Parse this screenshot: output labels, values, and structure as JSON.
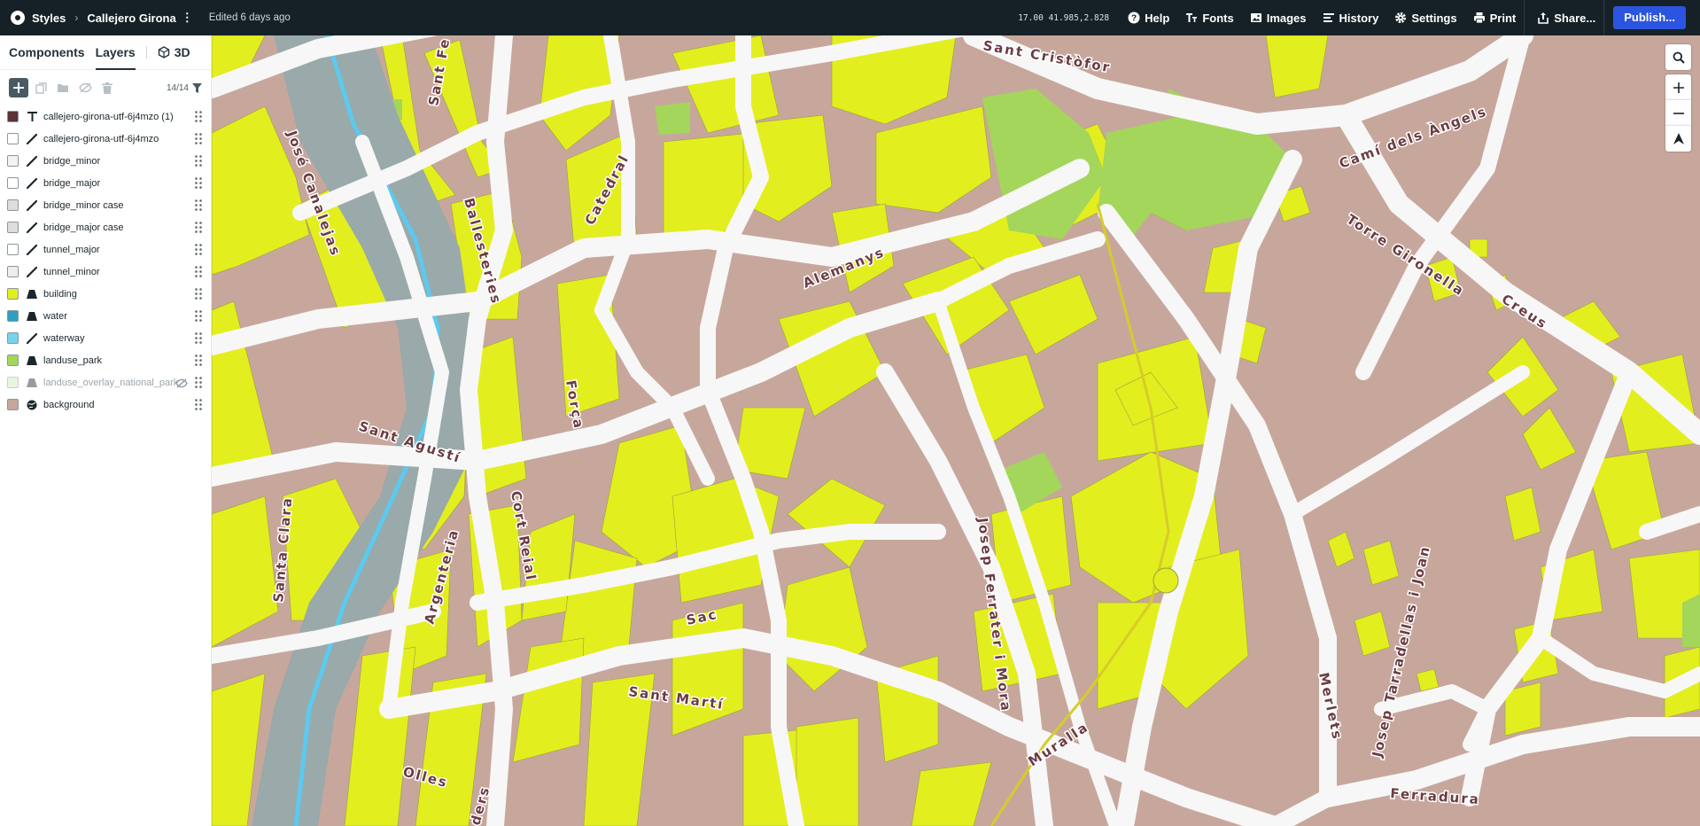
{
  "topbar": {
    "crumb_styles": "Styles",
    "crumb_map": "Callejero Girona",
    "edited": "Edited 6 days ago",
    "coords": "17.00 41.985,2.828",
    "help": "Help",
    "fonts": "Fonts",
    "images": "Images",
    "history": "History",
    "settings": "Settings",
    "print": "Print",
    "share": "Share...",
    "publish": "Publish..."
  },
  "sidebar": {
    "tabs": {
      "components": "Components",
      "layers": "Layers",
      "three_d": "3D"
    },
    "count": "14/14",
    "layers": [
      {
        "name": "callejero-girona-utf-6j4mzo (1)",
        "type": "symbol",
        "color": "#5a3338"
      },
      {
        "name": "callejero-girona-utf-6j4mzo",
        "type": "line",
        "color": "#ffffff"
      },
      {
        "name": "bridge_minor",
        "type": "line",
        "color": "#f3f3f3"
      },
      {
        "name": "bridge_major",
        "type": "line",
        "color": "#ffffff"
      },
      {
        "name": "bridge_minor case",
        "type": "line",
        "color": "#dddddd"
      },
      {
        "name": "bridge_major case",
        "type": "line",
        "color": "#dddddd"
      },
      {
        "name": "tunnel_major",
        "type": "line",
        "color": "#ffffff"
      },
      {
        "name": "tunnel_minor",
        "type": "line",
        "color": "#eeeeee"
      },
      {
        "name": "building",
        "type": "fill",
        "color": "#e3ee1f"
      },
      {
        "name": "water",
        "type": "fill",
        "color": "#2f9fc2"
      },
      {
        "name": "waterway",
        "type": "line",
        "color": "#76d2ef"
      },
      {
        "name": "landuse_park",
        "type": "fill",
        "color": "#a3d65a"
      },
      {
        "name": "landuse_overlay_national_park",
        "type": "fill",
        "color": "#cfe8b5",
        "hidden": true
      },
      {
        "name": "background",
        "type": "background",
        "color": "#c7a79c"
      }
    ]
  },
  "map": {
    "labels": {
      "sant_cristofor": "Sant Cristòfor",
      "cami_dels_angels": "Camí dels Àngels",
      "torre_gironella": "Torre Gironella",
      "creus": "Creus",
      "jose_canalejas": "José Canalejas",
      "ballesteries": "Ballesteries",
      "catedral": "Catedral",
      "alemanys": "Alemanys",
      "forca": "Força",
      "sant_agusti": "Sant Agustí",
      "santa_clara": "Santa Clara",
      "cort_reial": "Cort Reial",
      "argenteria": "Argenteria",
      "sac": "Sac",
      "sant_marti": "Sant Martí",
      "josep_ferrater": "Josep Ferrater i Mora",
      "muralla": "Muralla",
      "merlets": "Merlets",
      "josep_tarradellas": "Josep Tarradellas i Joan",
      "ferradura": "Ferradura",
      "olles": "Olles",
      "sant_fe": "Sant Fe",
      "ders": "ders"
    }
  },
  "colors": {
    "topbar": "#152127",
    "publish": "#2b55e0",
    "background": "#c7a79c",
    "building": "#e3ee1f",
    "road": "#f7f7f7",
    "water": "#9aa9a9",
    "waterway": "#5cc9ef",
    "park": "#a3d65a"
  }
}
